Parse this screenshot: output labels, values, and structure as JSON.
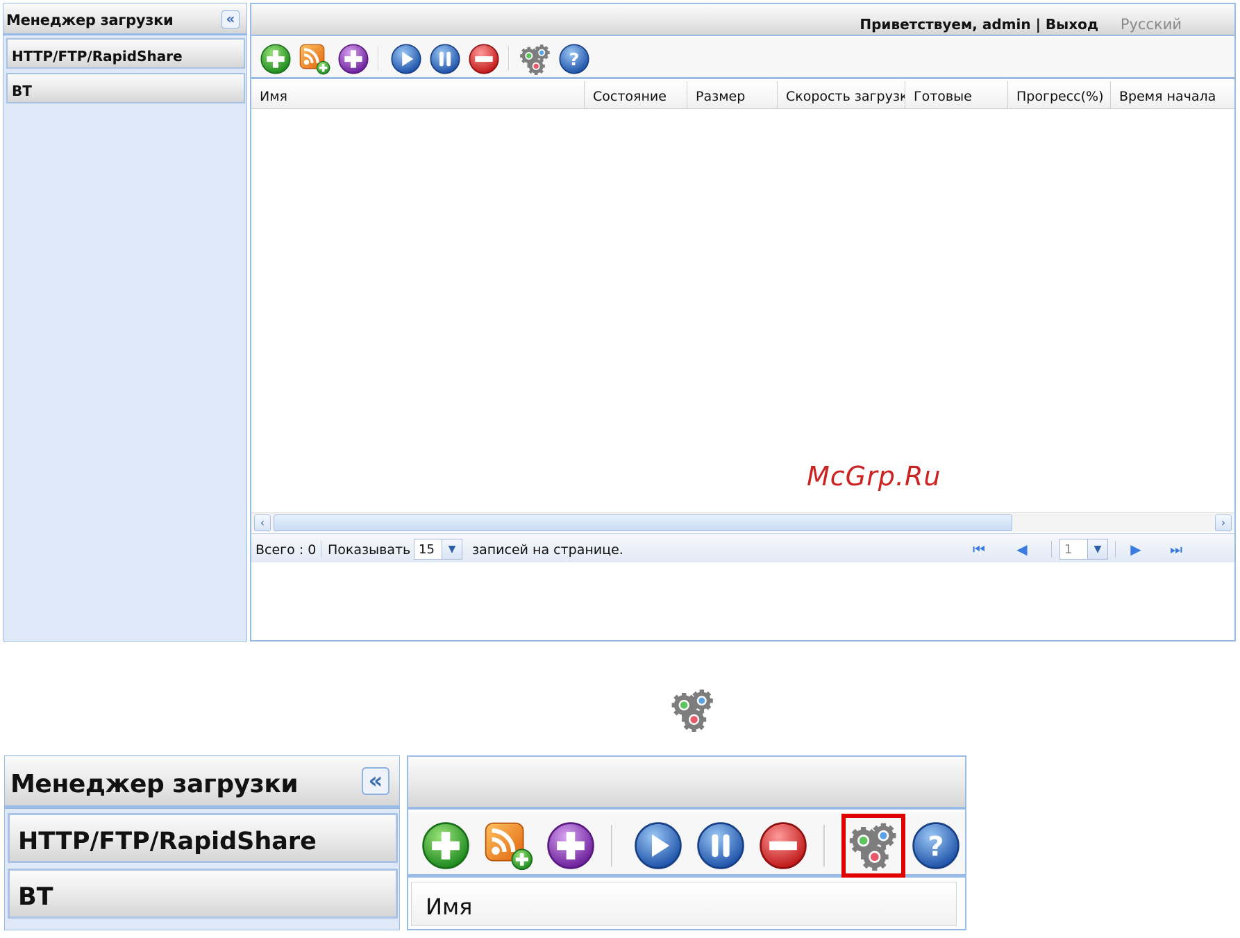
{
  "app": {
    "title": "Менеджер загрузки",
    "collapse_icon": "double-chevron-left-icon"
  },
  "sidebar": {
    "items": [
      {
        "label": "HTTP/FTP/RapidShare"
      },
      {
        "label": "BT"
      }
    ]
  },
  "header": {
    "greeting": "Приветствуем, admin",
    "separator": "|",
    "logout": "Выход",
    "language": "Русский"
  },
  "toolbar": {
    "buttons": [
      {
        "name": "add-task",
        "icon": "green-plus-icon",
        "color": "#3aa83a"
      },
      {
        "name": "add-rss",
        "icon": "rss-plus-icon",
        "color": "#f08a24"
      },
      {
        "name": "add-bt",
        "icon": "purple-plus-icon",
        "color": "#8a3db6"
      },
      {
        "name": "start",
        "icon": "play-icon",
        "color": "#2f6fc9"
      },
      {
        "name": "pause",
        "icon": "pause-icon",
        "color": "#2f6fc9"
      },
      {
        "name": "remove",
        "icon": "minus-icon",
        "color": "#d93030"
      },
      {
        "name": "settings",
        "icon": "gears-icon",
        "color": "#7a7a7a"
      },
      {
        "name": "help",
        "icon": "help-icon",
        "color": "#2f6fc9"
      }
    ]
  },
  "grid": {
    "columns": [
      "Имя",
      "Состояние",
      "Размер",
      "Скорость загрузки",
      "Готовые",
      "Прогресс(%)",
      "Время начала"
    ],
    "rows": []
  },
  "paging": {
    "total_label": "Всего : 0",
    "show_label": "Показывать",
    "page_size": "15",
    "per_page_label": "записей на странице.",
    "current_page": "1"
  },
  "watermark": "McGrp.Ru",
  "zoom": {
    "highlight_color": "#e00000",
    "column": "Имя"
  },
  "colors": {
    "border_blue": "#99bbe8",
    "sidebar_bg": "#dfe8f6"
  }
}
